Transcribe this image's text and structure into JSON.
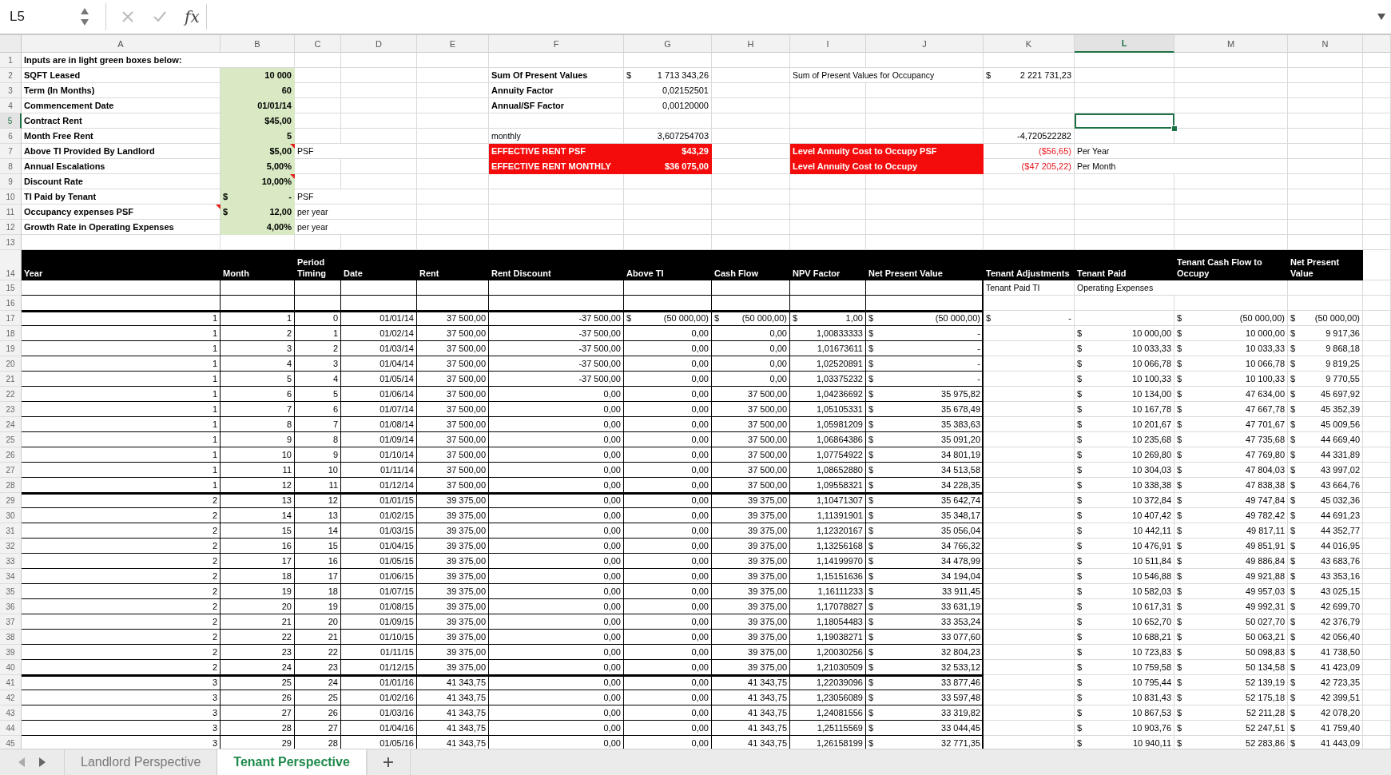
{
  "formula_bar": {
    "cell_reference": "L5",
    "function_label": "fx"
  },
  "sheet": {
    "columns": [
      {
        "label": "A",
        "selected": false
      },
      {
        "label": "B",
        "selected": false
      },
      {
        "label": "C",
        "selected": false
      },
      {
        "label": "D",
        "selected": false
      },
      {
        "label": "E",
        "selected": false
      },
      {
        "label": "F",
        "selected": false
      },
      {
        "label": "G",
        "selected": false
      },
      {
        "label": "H",
        "selected": false
      },
      {
        "label": "I",
        "selected": false
      },
      {
        "label": "J",
        "selected": false
      },
      {
        "label": "K",
        "selected": false
      },
      {
        "label": "L",
        "selected": true
      },
      {
        "label": "M",
        "selected": false
      },
      {
        "label": "N",
        "selected": false
      }
    ],
    "rows": [
      {
        "label": "1",
        "selected": false,
        "kind": "plain",
        "cells": {
          "A": {
            "kind": "title",
            "text": "Inputs are in light green boxes below:"
          }
        }
      },
      {
        "label": "2",
        "selected": false,
        "kind": "plain",
        "cells": {
          "A": {
            "kind": "label",
            "text": "SQFT Leased"
          },
          "B": {
            "kind": "input",
            "text": "10 000"
          },
          "F": {
            "kind": "stat",
            "text": "Sum Of Present Values"
          },
          "G": {
            "kind": "value",
            "sign": "$",
            "text": "1 713 343,26"
          },
          "I": {
            "kind": "note",
            "text": "Sum of Present Values for Occupancy"
          },
          "K": {
            "kind": "value",
            "sign": "$",
            "text": "2 221 731,23"
          }
        }
      },
      {
        "label": "3",
        "selected": false,
        "kind": "plain",
        "cells": {
          "A": {
            "kind": "label",
            "text": "Term (In Months)"
          },
          "B": {
            "kind": "input",
            "text": "60"
          },
          "F": {
            "kind": "stat",
            "text": "Annuity Factor"
          },
          "G": {
            "kind": "value",
            "text": "0,02152501"
          }
        }
      },
      {
        "label": "4",
        "selected": false,
        "kind": "plain",
        "cells": {
          "A": {
            "kind": "label",
            "text": "Commencement Date"
          },
          "B": {
            "kind": "input",
            "text": "01/01/14"
          },
          "F": {
            "kind": "stat",
            "text": "Annual/SF Factor"
          },
          "G": {
            "kind": "value",
            "text": "0,00120000"
          }
        }
      },
      {
        "label": "5",
        "selected": true,
        "kind": "plain",
        "cells": {
          "A": {
            "kind": "label",
            "text": "Contract Rent"
          },
          "B": {
            "kind": "input",
            "text": "$45,00"
          }
        }
      },
      {
        "label": "6",
        "selected": false,
        "kind": "plain",
        "cells": {
          "A": {
            "kind": "label",
            "text": "Month Free Rent"
          },
          "B": {
            "kind": "input",
            "text": "5"
          },
          "F": {
            "kind": "note",
            "text": "monthly"
          },
          "G": {
            "kind": "value",
            "text": "3,607254703"
          },
          "K": {
            "kind": "value",
            "text": "-4,720522282"
          }
        }
      },
      {
        "label": "7",
        "selected": false,
        "kind": "plain",
        "cells": {
          "A": {
            "kind": "label",
            "text": "Above TI Provided By Landlord"
          },
          "B": {
            "kind": "input",
            "text": "$5,00",
            "comment": true
          },
          "C": {
            "kind": "note",
            "text": "PSF"
          },
          "F": {
            "kind": "alert",
            "text": "EFFECTIVE RENT PSF"
          },
          "G": {
            "kind": "alert_value",
            "text": "$43,29"
          },
          "I": {
            "kind": "alert",
            "text": "Level Annuity Cost to Occupy PSF"
          },
          "K": {
            "kind": "negative",
            "text": "($56,65)"
          },
          "L": {
            "kind": "note",
            "text": "Per Year"
          }
        }
      },
      {
        "label": "8",
        "selected": false,
        "kind": "plain",
        "cells": {
          "A": {
            "kind": "label",
            "text": "Annual Escalations"
          },
          "B": {
            "kind": "input",
            "text": "5,00%"
          },
          "F": {
            "kind": "alert",
            "text": "EFFECTIVE RENT MONTHLY"
          },
          "G": {
            "kind": "alert_value",
            "text": "$36 075,00"
          },
          "I": {
            "kind": "alert",
            "text": "Level Annuity Cost to Occupy"
          },
          "K": {
            "kind": "negative",
            "text": "($47 205,22)"
          },
          "L": {
            "kind": "note",
            "text": "Per Month"
          }
        }
      },
      {
        "label": "9",
        "selected": false,
        "kind": "plain",
        "cells": {
          "A": {
            "kind": "label",
            "text": "Discount Rate"
          },
          "B": {
            "kind": "input",
            "text": "10,00%",
            "comment": true
          }
        }
      },
      {
        "label": "10",
        "selected": false,
        "kind": "plain",
        "cells": {
          "A": {
            "kind": "label",
            "text": "TI Paid by Tenant"
          },
          "B": {
            "kind": "input",
            "sign": "$",
            "text": "-"
          },
          "C": {
            "kind": "note",
            "text": "PSF"
          }
        }
      },
      {
        "label": "11",
        "selected": false,
        "kind": "plain",
        "cells": {
          "A": {
            "kind": "label",
            "text": "Occupancy expenses PSF",
            "comment": true
          },
          "B": {
            "kind": "input",
            "sign": "$",
            "text": "12,00"
          },
          "C": {
            "kind": "note",
            "text": "per year"
          }
        }
      },
      {
        "label": "12",
        "selected": false,
        "kind": "plain",
        "cells": {
          "A": {
            "kind": "label",
            "text": "Growth Rate in Operating Expenses"
          },
          "B": {
            "kind": "input",
            "text": "4,00%"
          },
          "C": {
            "kind": "note",
            "text": "per year"
          }
        }
      },
      {
        "label": "13",
        "selected": false,
        "kind": "plain"
      },
      {
        "label": "14",
        "selected": false,
        "kind": "header",
        "cells": {
          "A": "Year",
          "B": "Month",
          "C": "Period Timing",
          "D": "Date",
          "E": "Rent",
          "F": "Rent Discount",
          "G": "Above TI",
          "H": "Cash Flow",
          "I": "NPV Factor",
          "J": "Net Present Value",
          "K": "Tenant Adjustments",
          "L": "Tenant Paid",
          "M": "Tenant Cash Flow to Occupy",
          "N": "Net Present Value"
        }
      },
      {
        "label": "15",
        "selected": false,
        "kind": "table",
        "cells": {
          "K": {
            "kind": "note",
            "text": "Tenant Paid TI"
          },
          "L": {
            "kind": "note",
            "text": "Operating Expenses"
          }
        }
      },
      {
        "label": "16",
        "selected": false,
        "kind": "table"
      },
      {
        "label": "17",
        "selected": false,
        "kind": "data",
        "cells": {
          "A": "1",
          "B": "1",
          "C": "0",
          "D": "01/01/14",
          "E": "37 500,00",
          "F": "-37 500,00",
          "G": [
            "$",
            "(50 000,00)"
          ],
          "H": [
            "$",
            "(50 000,00)"
          ],
          "I": [
            "$",
            "1,00"
          ],
          "J": [
            "$",
            "(50 000,00)"
          ],
          "K": [
            "$",
            "-"
          ],
          "M": [
            "$",
            "(50 000,00)"
          ],
          "N": [
            "$",
            "(50 000,00)"
          ]
        }
      },
      {
        "label": "18",
        "selected": false,
        "kind": "data",
        "cells": {
          "A": "1",
          "B": "2",
          "C": "1",
          "D": "01/02/14",
          "E": "37 500,00",
          "F": "-37 500,00",
          "G": "0,00",
          "H": "0,00",
          "I": "1,00833333",
          "J": [
            "$",
            "-"
          ],
          "L": [
            "$",
            "10 000,00"
          ],
          "M": [
            "$",
            "10 000,00"
          ],
          "N": [
            "$",
            "9 917,36"
          ]
        }
      },
      {
        "label": "19",
        "selected": false,
        "kind": "data",
        "cells": {
          "A": "1",
          "B": "3",
          "C": "2",
          "D": "01/03/14",
          "E": "37 500,00",
          "F": "-37 500,00",
          "G": "0,00",
          "H": "0,00",
          "I": "1,01673611",
          "J": [
            "$",
            "-"
          ],
          "L": [
            "$",
            "10 033,33"
          ],
          "M": [
            "$",
            "10 033,33"
          ],
          "N": [
            "$",
            "9 868,18"
          ]
        }
      },
      {
        "label": "20",
        "selected": false,
        "kind": "data",
        "cells": {
          "A": "1",
          "B": "4",
          "C": "3",
          "D": "01/04/14",
          "E": "37 500,00",
          "F": "-37 500,00",
          "G": "0,00",
          "H": "0,00",
          "I": "1,02520891",
          "J": [
            "$",
            "-"
          ],
          "L": [
            "$",
            "10 066,78"
          ],
          "M": [
            "$",
            "10 066,78"
          ],
          "N": [
            "$",
            "9 819,25"
          ]
        }
      },
      {
        "label": "21",
        "selected": false,
        "kind": "data",
        "cells": {
          "A": "1",
          "B": "5",
          "C": "4",
          "D": "01/05/14",
          "E": "37 500,00",
          "F": "-37 500,00",
          "G": "0,00",
          "H": "0,00",
          "I": "1,03375232",
          "J": [
            "$",
            "-"
          ],
          "L": [
            "$",
            "10 100,33"
          ],
          "M": [
            "$",
            "10 100,33"
          ],
          "N": [
            "$",
            "9 770,55"
          ]
        }
      },
      {
        "label": "22",
        "selected": false,
        "kind": "data",
        "cells": {
          "A": "1",
          "B": "6",
          "C": "5",
          "D": "01/06/14",
          "E": "37 500,00",
          "F": "0,00",
          "G": "0,00",
          "H": "37 500,00",
          "I": "1,04236692",
          "J": [
            "$",
            "35 975,82"
          ],
          "L": [
            "$",
            "10 134,00"
          ],
          "M": [
            "$",
            "47 634,00"
          ],
          "N": [
            "$",
            "45 697,92"
          ]
        }
      },
      {
        "label": "23",
        "selected": false,
        "kind": "data",
        "cells": {
          "A": "1",
          "B": "7",
          "C": "6",
          "D": "01/07/14",
          "E": "37 500,00",
          "F": "0,00",
          "G": "0,00",
          "H": "37 500,00",
          "I": "1,05105331",
          "J": [
            "$",
            "35 678,49"
          ],
          "L": [
            "$",
            "10 167,78"
          ],
          "M": [
            "$",
            "47 667,78"
          ],
          "N": [
            "$",
            "45 352,39"
          ]
        }
      },
      {
        "label": "24",
        "selected": false,
        "kind": "data",
        "cells": {
          "A": "1",
          "B": "8",
          "C": "7",
          "D": "01/08/14",
          "E": "37 500,00",
          "F": "0,00",
          "G": "0,00",
          "H": "37 500,00",
          "I": "1,05981209",
          "J": [
            "$",
            "35 383,63"
          ],
          "L": [
            "$",
            "10 201,67"
          ],
          "M": [
            "$",
            "47 701,67"
          ],
          "N": [
            "$",
            "45 009,56"
          ]
        }
      },
      {
        "label": "25",
        "selected": false,
        "kind": "data",
        "cells": {
          "A": "1",
          "B": "9",
          "C": "8",
          "D": "01/09/14",
          "E": "37 500,00",
          "F": "0,00",
          "G": "0,00",
          "H": "37 500,00",
          "I": "1,06864386",
          "J": [
            "$",
            "35 091,20"
          ],
          "L": [
            "$",
            "10 235,68"
          ],
          "M": [
            "$",
            "47 735,68"
          ],
          "N": [
            "$",
            "44 669,40"
          ]
        }
      },
      {
        "label": "26",
        "selected": false,
        "kind": "data",
        "cells": {
          "A": "1",
          "B": "10",
          "C": "9",
          "D": "01/10/14",
          "E": "37 500,00",
          "F": "0,00",
          "G": "0,00",
          "H": "37 500,00",
          "I": "1,07754922",
          "J": [
            "$",
            "34 801,19"
          ],
          "L": [
            "$",
            "10 269,80"
          ],
          "M": [
            "$",
            "47 769,80"
          ],
          "N": [
            "$",
            "44 331,89"
          ]
        }
      },
      {
        "label": "27",
        "selected": false,
        "kind": "data",
        "cells": {
          "A": "1",
          "B": "11",
          "C": "10",
          "D": "01/11/14",
          "E": "37 500,00",
          "F": "0,00",
          "G": "0,00",
          "H": "37 500,00",
          "I": "1,08652880",
          "J": [
            "$",
            "34 513,58"
          ],
          "L": [
            "$",
            "10 304,03"
          ],
          "M": [
            "$",
            "47 804,03"
          ],
          "N": [
            "$",
            "43 997,02"
          ]
        }
      },
      {
        "label": "28",
        "selected": false,
        "kind": "data",
        "cells": {
          "A": "1",
          "B": "12",
          "C": "11",
          "D": "01/12/14",
          "E": "37 500,00",
          "F": "0,00",
          "G": "0,00",
          "H": "37 500,00",
          "I": "1,09558321",
          "J": [
            "$",
            "34 228,35"
          ],
          "L": [
            "$",
            "10 338,38"
          ],
          "M": [
            "$",
            "47 838,38"
          ],
          "N": [
            "$",
            "43 664,76"
          ]
        }
      },
      {
        "label": "29",
        "selected": false,
        "kind": "data",
        "cells": {
          "A": "2",
          "B": "13",
          "C": "12",
          "D": "01/01/15",
          "E": "39 375,00",
          "F": "0,00",
          "G": "0,00",
          "H": "39 375,00",
          "I": "1,10471307",
          "J": [
            "$",
            "35 642,74"
          ],
          "L": [
            "$",
            "10 372,84"
          ],
          "M": [
            "$",
            "49 747,84"
          ],
          "N": [
            "$",
            "45 032,36"
          ]
        }
      },
      {
        "label": "30",
        "selected": false,
        "kind": "data",
        "cells": {
          "A": "2",
          "B": "14",
          "C": "13",
          "D": "01/02/15",
          "E": "39 375,00",
          "F": "0,00",
          "G": "0,00",
          "H": "39 375,00",
          "I": "1,11391901",
          "J": [
            "$",
            "35 348,17"
          ],
          "L": [
            "$",
            "10 407,42"
          ],
          "M": [
            "$",
            "49 782,42"
          ],
          "N": [
            "$",
            "44 691,23"
          ]
        }
      },
      {
        "label": "31",
        "selected": false,
        "kind": "data",
        "cells": {
          "A": "2",
          "B": "15",
          "C": "14",
          "D": "01/03/15",
          "E": "39 375,00",
          "F": "0,00",
          "G": "0,00",
          "H": "39 375,00",
          "I": "1,12320167",
          "J": [
            "$",
            "35 056,04"
          ],
          "L": [
            "$",
            "10 442,11"
          ],
          "M": [
            "$",
            "49 817,11"
          ],
          "N": [
            "$",
            "44 352,77"
          ]
        }
      },
      {
        "label": "32",
        "selected": false,
        "kind": "data",
        "cells": {
          "A": "2",
          "B": "16",
          "C": "15",
          "D": "01/04/15",
          "E": "39 375,00",
          "F": "0,00",
          "G": "0,00",
          "H": "39 375,00",
          "I": "1,13256168",
          "J": [
            "$",
            "34 766,32"
          ],
          "L": [
            "$",
            "10 476,91"
          ],
          "M": [
            "$",
            "49 851,91"
          ],
          "N": [
            "$",
            "44 016,95"
          ]
        }
      },
      {
        "label": "33",
        "selected": false,
        "kind": "data",
        "cells": {
          "A": "2",
          "B": "17",
          "C": "16",
          "D": "01/05/15",
          "E": "39 375,00",
          "F": "0,00",
          "G": "0,00",
          "H": "39 375,00",
          "I": "1,14199970",
          "J": [
            "$",
            "34 478,99"
          ],
          "L": [
            "$",
            "10 511,84"
          ],
          "M": [
            "$",
            "49 886,84"
          ],
          "N": [
            "$",
            "43 683,76"
          ]
        }
      },
      {
        "label": "34",
        "selected": false,
        "kind": "data",
        "cells": {
          "A": "2",
          "B": "18",
          "C": "17",
          "D": "01/06/15",
          "E": "39 375,00",
          "F": "0,00",
          "G": "0,00",
          "H": "39 375,00",
          "I": "1,15151636",
          "J": [
            "$",
            "34 194,04"
          ],
          "L": [
            "$",
            "10 546,88"
          ],
          "M": [
            "$",
            "49 921,88"
          ],
          "N": [
            "$",
            "43 353,16"
          ]
        }
      },
      {
        "label": "35",
        "selected": false,
        "kind": "data",
        "cells": {
          "A": "2",
          "B": "19",
          "C": "18",
          "D": "01/07/15",
          "E": "39 375,00",
          "F": "0,00",
          "G": "0,00",
          "H": "39 375,00",
          "I": "1,16111233",
          "J": [
            "$",
            "33 911,45"
          ],
          "L": [
            "$",
            "10 582,03"
          ],
          "M": [
            "$",
            "49 957,03"
          ],
          "N": [
            "$",
            "43 025,15"
          ]
        }
      },
      {
        "label": "36",
        "selected": false,
        "kind": "data",
        "cells": {
          "A": "2",
          "B": "20",
          "C": "19",
          "D": "01/08/15",
          "E": "39 375,00",
          "F": "0,00",
          "G": "0,00",
          "H": "39 375,00",
          "I": "1,17078827",
          "J": [
            "$",
            "33 631,19"
          ],
          "L": [
            "$",
            "10 617,31"
          ],
          "M": [
            "$",
            "49 992,31"
          ],
          "N": [
            "$",
            "42 699,70"
          ]
        }
      },
      {
        "label": "37",
        "selected": false,
        "kind": "data",
        "cells": {
          "A": "2",
          "B": "21",
          "C": "20",
          "D": "01/09/15",
          "E": "39 375,00",
          "F": "0,00",
          "G": "0,00",
          "H": "39 375,00",
          "I": "1,18054483",
          "J": [
            "$",
            "33 353,24"
          ],
          "L": [
            "$",
            "10 652,70"
          ],
          "M": [
            "$",
            "50 027,70"
          ],
          "N": [
            "$",
            "42 376,79"
          ]
        }
      },
      {
        "label": "38",
        "selected": false,
        "kind": "data",
        "cells": {
          "A": "2",
          "B": "22",
          "C": "21",
          "D": "01/10/15",
          "E": "39 375,00",
          "F": "0,00",
          "G": "0,00",
          "H": "39 375,00",
          "I": "1,19038271",
          "J": [
            "$",
            "33 077,60"
          ],
          "L": [
            "$",
            "10 688,21"
          ],
          "M": [
            "$",
            "50 063,21"
          ],
          "N": [
            "$",
            "42 056,40"
          ]
        }
      },
      {
        "label": "39",
        "selected": false,
        "kind": "data",
        "cells": {
          "A": "2",
          "B": "23",
          "C": "22",
          "D": "01/11/15",
          "E": "39 375,00",
          "F": "0,00",
          "G": "0,00",
          "H": "39 375,00",
          "I": "1,20030256",
          "J": [
            "$",
            "32 804,23"
          ],
          "L": [
            "$",
            "10 723,83"
          ],
          "M": [
            "$",
            "50 098,83"
          ],
          "N": [
            "$",
            "41 738,50"
          ]
        }
      },
      {
        "label": "40",
        "selected": false,
        "kind": "data",
        "cells": {
          "A": "2",
          "B": "24",
          "C": "23",
          "D": "01/12/15",
          "E": "39 375,00",
          "F": "0,00",
          "G": "0,00",
          "H": "39 375,00",
          "I": "1,21030509",
          "J": [
            "$",
            "32 533,12"
          ],
          "L": [
            "$",
            "10 759,58"
          ],
          "M": [
            "$",
            "50 134,58"
          ],
          "N": [
            "$",
            "41 423,09"
          ]
        }
      },
      {
        "label": "41",
        "selected": false,
        "kind": "data",
        "cells": {
          "A": "3",
          "B": "25",
          "C": "24",
          "D": "01/01/16",
          "E": "41 343,75",
          "F": "0,00",
          "G": "0,00",
          "H": "41 343,75",
          "I": "1,22039096",
          "J": [
            "$",
            "33 877,46"
          ],
          "L": [
            "$",
            "10 795,44"
          ],
          "M": [
            "$",
            "52 139,19"
          ],
          "N": [
            "$",
            "42 723,35"
          ]
        }
      },
      {
        "label": "42",
        "selected": false,
        "kind": "data",
        "cells": {
          "A": "3",
          "B": "26",
          "C": "25",
          "D": "01/02/16",
          "E": "41 343,75",
          "F": "0,00",
          "G": "0,00",
          "H": "41 343,75",
          "I": "1,23056089",
          "J": [
            "$",
            "33 597,48"
          ],
          "L": [
            "$",
            "10 831,43"
          ],
          "M": [
            "$",
            "52 175,18"
          ],
          "N": [
            "$",
            "42 399,51"
          ]
        }
      },
      {
        "label": "43",
        "selected": false,
        "kind": "data",
        "cells": {
          "A": "3",
          "B": "27",
          "C": "26",
          "D": "01/03/16",
          "E": "41 343,75",
          "F": "0,00",
          "G": "0,00",
          "H": "41 343,75",
          "I": "1,24081556",
          "J": [
            "$",
            "33 319,82"
          ],
          "L": [
            "$",
            "10 867,53"
          ],
          "M": [
            "$",
            "52 211,28"
          ],
          "N": [
            "$",
            "42 078,20"
          ]
        }
      },
      {
        "label": "44",
        "selected": false,
        "kind": "data",
        "cells": {
          "A": "3",
          "B": "28",
          "C": "27",
          "D": "01/04/16",
          "E": "41 343,75",
          "F": "0,00",
          "G": "0,00",
          "H": "41 343,75",
          "I": "1,25115569",
          "J": [
            "$",
            "33 044,45"
          ],
          "L": [
            "$",
            "10 903,76"
          ],
          "M": [
            "$",
            "52 247,51"
          ],
          "N": [
            "$",
            "41 759,40"
          ]
        }
      },
      {
        "label": "45",
        "selected": false,
        "kind": "data",
        "cells": {
          "A": "3",
          "B": "29",
          "C": "28",
          "D": "01/05/16",
          "E": "41 343,75",
          "F": "0,00",
          "G": "0,00",
          "H": "41 343,75",
          "I": "1,26158199",
          "J": [
            "$",
            "32 771,35"
          ],
          "L": [
            "$",
            "10 940,11"
          ],
          "M": [
            "$",
            "52 283,86"
          ],
          "N": [
            "$",
            "41 443,09"
          ]
        }
      }
    ]
  },
  "sheet_tabs": [
    {
      "label": "Landlord Perspective",
      "selected": false
    },
    {
      "label": "Tenant Perspective",
      "selected": true
    }
  ]
}
